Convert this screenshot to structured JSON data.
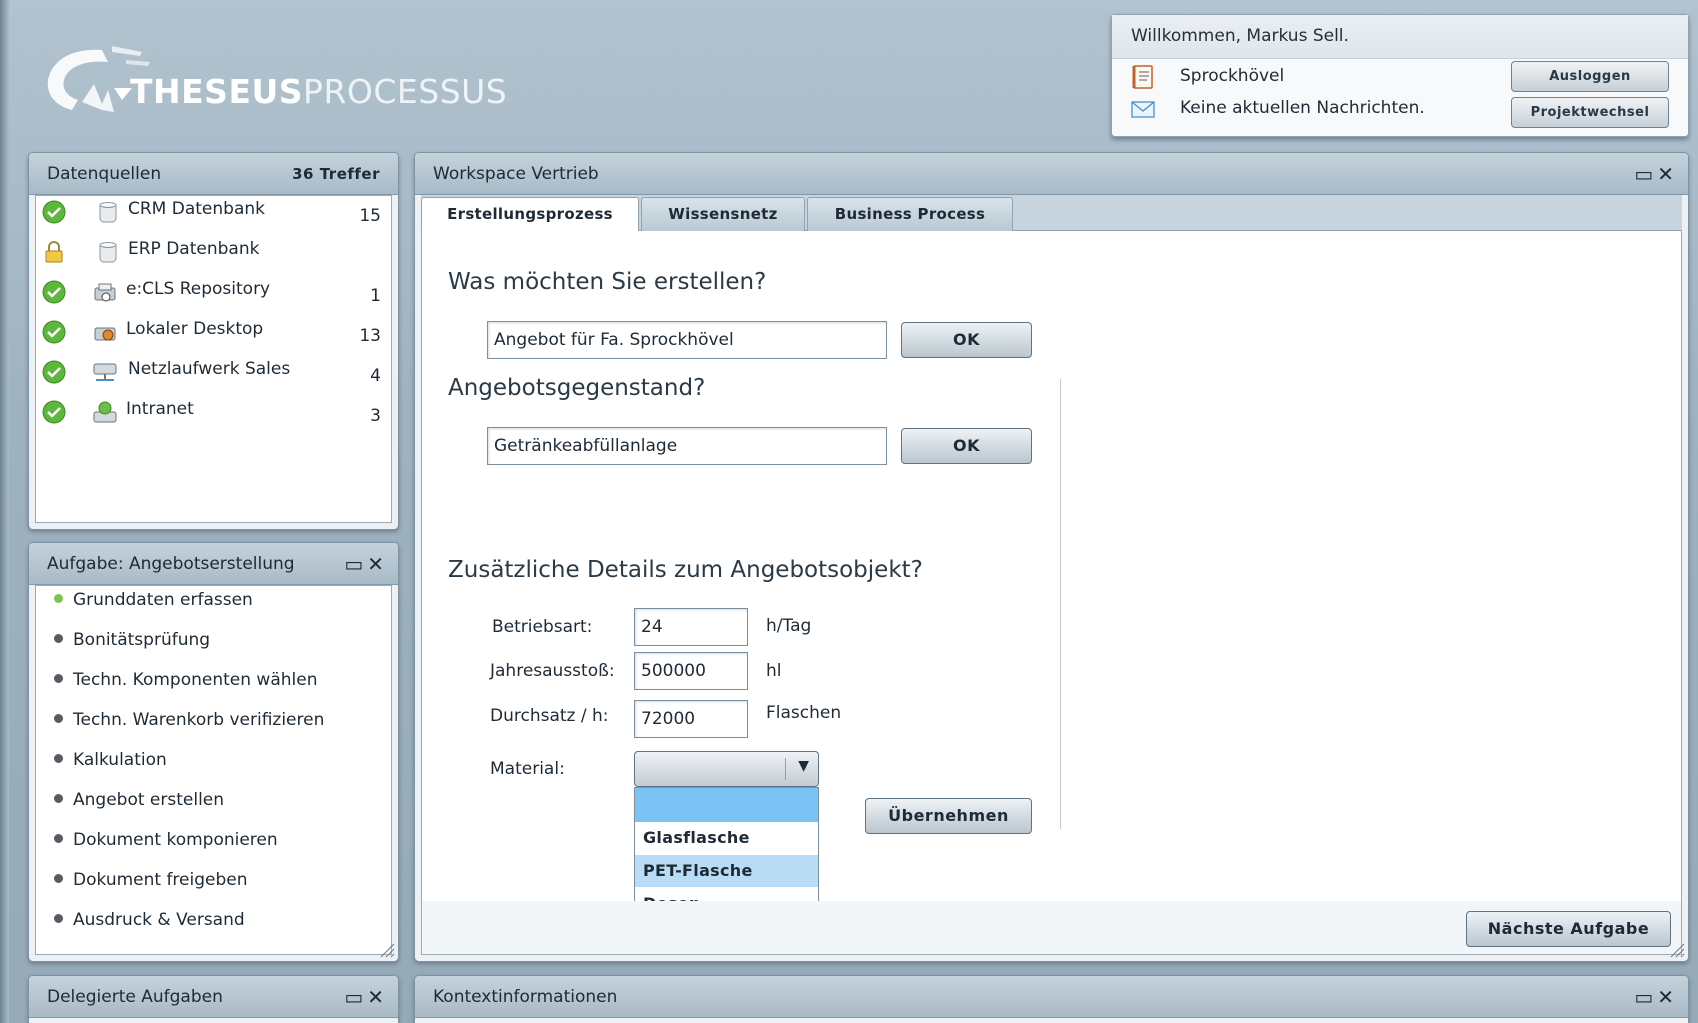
{
  "logo": {
    "bold": "THESEUS",
    "light": "PROCESSUS"
  },
  "user": {
    "welcome": "Willkommen, Markus Sell.",
    "project": "Sprockhövel",
    "messages": "Keine aktuellen Nachrichten.",
    "logout_label": "Ausloggen",
    "switch_label": "Projektwechsel"
  },
  "datasources": {
    "title": "Datenquellen",
    "hits": "36 Treffer",
    "items": [
      {
        "name": "CRM Datenbank",
        "count": "15",
        "status": "ok"
      },
      {
        "name": "ERP Datenbank",
        "count": "",
        "status": "locked"
      },
      {
        "name": "e:CLS Repository",
        "count": "1",
        "status": "ok"
      },
      {
        "name": "Lokaler Desktop",
        "count": "13",
        "status": "ok"
      },
      {
        "name": "Netzlaufwerk Sales",
        "count": "4",
        "status": "ok"
      },
      {
        "name": "Intranet",
        "count": "3",
        "status": "ok"
      }
    ]
  },
  "task_panel": {
    "title": "Aufgabe: Angebotserstellung",
    "steps": [
      "Grunddaten erfassen",
      "Bonitätsprüfung",
      "Techn. Komponenten wählen",
      "Techn. Warenkorb verifizieren",
      "Kalkulation",
      "Angebot erstellen",
      "Dokument komponieren",
      "Dokument freigeben",
      "Ausdruck & Versand"
    ]
  },
  "delegated": {
    "title": "Delegierte Aufgaben"
  },
  "context": {
    "title": "Kontextinformationen"
  },
  "workspace": {
    "title": "Workspace Vertrieb",
    "tabs": [
      "Erstellungsprozess",
      "Wissensnetz",
      "Business Process"
    ],
    "q1": "Was möchten Sie erstellen?",
    "q1_value": "Angebot für Fa. Sprockhövel",
    "q2": "Angebotsgegenstand?",
    "q2_value": "Getränkeabfüllanlage",
    "ok_label": "OK",
    "q3": "Zusätzliche Details zum Angebotsobjekt?",
    "betriebsart_label": "Betriebsart:",
    "betriebsart_value": "24",
    "betriebsart_unit": "h/Tag",
    "jahres_label": "Jahresausstoß:",
    "jahres_value": "500000",
    "jahres_unit": "hl",
    "durchsatz_label": "Durchsatz / h:",
    "durchsatz_value": "72000",
    "durchsatz_unit": "Flaschen",
    "material_label": "Material:",
    "material_options": [
      "Glasflasche",
      "PET-Flasche",
      "Dosen"
    ],
    "apply_label": "Übernehmen",
    "next_label": "Nächste Aufgabe"
  },
  "colors": {
    "ok": "#5cb83a",
    "dropdown_selected": "#7cc3f5",
    "dropdown_hover": "#b7dcf4"
  }
}
